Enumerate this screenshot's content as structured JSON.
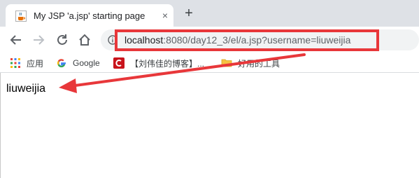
{
  "tab": {
    "title": "My JSP 'a.jsp' starting page",
    "close_symbol": "×",
    "favicon": "java-cup-icon"
  },
  "new_tab_symbol": "+",
  "toolbar": {
    "back_icon": "back-arrow-icon",
    "forward_icon": "forward-arrow-icon",
    "reload_icon": "reload-icon",
    "home_icon": "home-icon"
  },
  "omnibox": {
    "info_icon": "info-icon",
    "host": "localhost",
    "rest": ":8080/day12_3/el/a.jsp?username=liuweijia"
  },
  "bookmarks": [
    {
      "label": "应用",
      "icon": "apps-grid-icon"
    },
    {
      "label": "Google",
      "icon": "google-g-icon"
    },
    {
      "label": "【刘伟佳的博客】...",
      "icon": "csdn-c-icon"
    },
    {
      "label": "好用的工具",
      "icon": "folder-icon"
    }
  ],
  "page": {
    "body_text": "liuweijia"
  },
  "colors": {
    "annotation_red": "#e8373a",
    "tabstrip_bg": "#dee1e6",
    "omnibox_bg": "#f1f3f4"
  }
}
